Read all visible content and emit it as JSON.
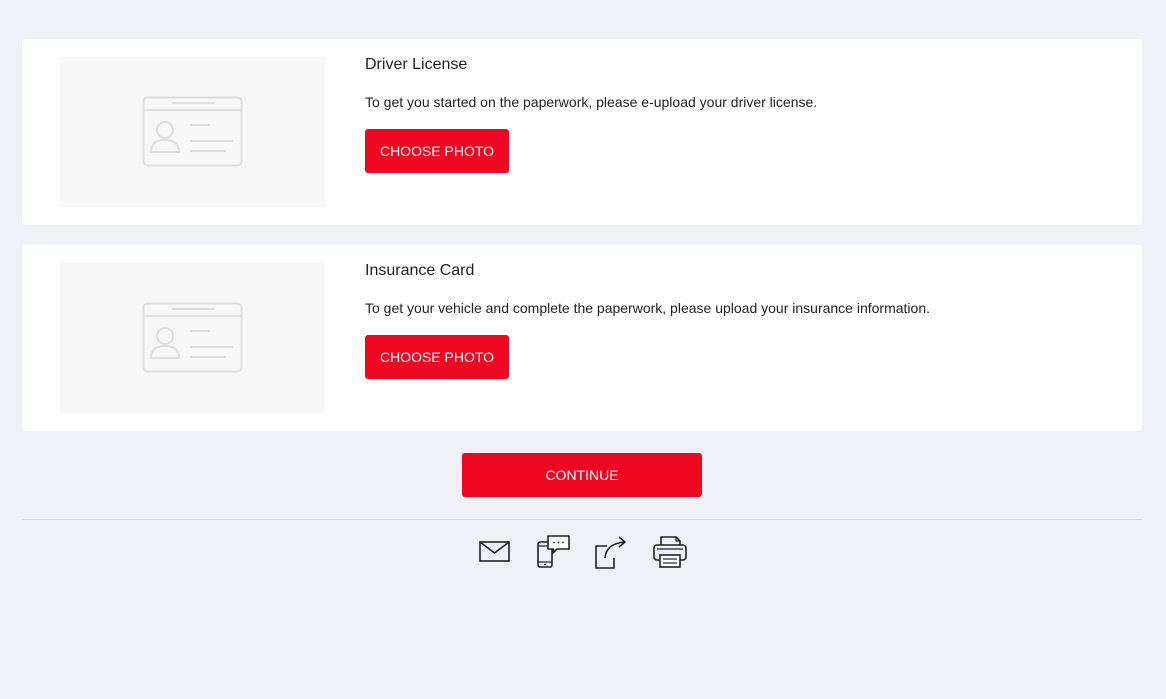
{
  "cards": [
    {
      "title": "Driver License",
      "description": "To get you started on the paperwork, please e-upload your driver license.",
      "button_label": "CHOOSE PHOTO"
    },
    {
      "title": "Insurance Card",
      "description": "To get your vehicle and complete the paperwork, please upload your insurance information.",
      "button_label": "CHOOSE PHOTO"
    }
  ],
  "continue_label": "CONTINUE",
  "share_icons": [
    "email-icon",
    "text-message-icon",
    "share-icon",
    "print-icon"
  ],
  "colors": {
    "accent": "#ee0720",
    "background": "#f0f1f6",
    "card": "#ffffff",
    "placeholder": "#f7f7f7"
  }
}
